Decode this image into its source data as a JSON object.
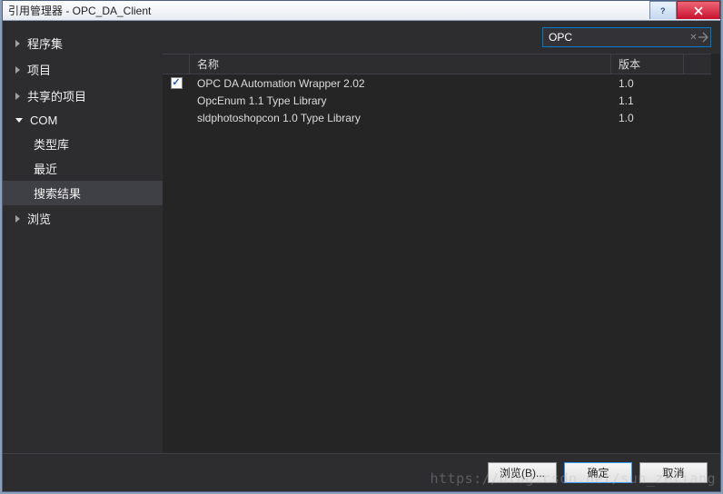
{
  "window": {
    "title": "引用管理器 - OPC_DA_Client"
  },
  "sidebar": {
    "items": [
      {
        "label": "程序集",
        "expanded": false
      },
      {
        "label": "项目",
        "expanded": false
      },
      {
        "label": "共享的项目",
        "expanded": false
      },
      {
        "label": "COM",
        "expanded": true,
        "children": [
          {
            "label": "类型库",
            "selected": false
          },
          {
            "label": "最近",
            "selected": false
          },
          {
            "label": "搜索结果",
            "selected": true
          }
        ]
      },
      {
        "label": "浏览",
        "expanded": false
      }
    ]
  },
  "search": {
    "value": "OPC"
  },
  "table": {
    "headers": {
      "name": "名称",
      "version": "版本"
    },
    "rows": [
      {
        "checked": true,
        "name": "OPC DA Automation Wrapper 2.02",
        "version": "1.0"
      },
      {
        "checked": false,
        "name": "OpcEnum 1.1 Type Library",
        "version": "1.1"
      },
      {
        "checked": false,
        "name": "sldphotoshopcon 1.0 Type Library",
        "version": "1.0"
      }
    ]
  },
  "footer": {
    "browse": "浏览(B)...",
    "ok": "确定",
    "cancel": "取消"
  },
  "watermark": "https://blog.csdn.net/sun_zeliang"
}
